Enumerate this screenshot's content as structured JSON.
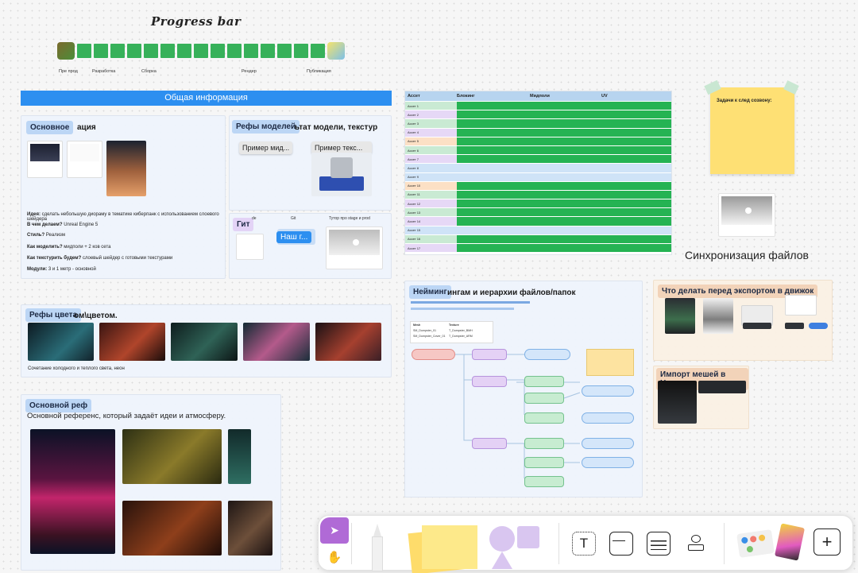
{
  "progress": {
    "title": "Progress bar",
    "done_fraction": 1.0,
    "stages": [
      "Пре прод",
      "Разработка",
      "Сборка",
      "Рендер",
      "Публикация"
    ]
  },
  "general": {
    "banner": "Общая информация"
  },
  "basic": {
    "tag": "Основное",
    "heading_rest": "ация",
    "idea_label": "Идея:",
    "idea_text": "сделать небольшую диораму в тематике киберпанк с использованием слоевого шейдера",
    "engine_label": "В чем делаем?",
    "engine_text": "Unreal Engine 5",
    "style_label": "Стиль?",
    "style_text": "Реализм",
    "model_label": "Как моделить?",
    "model_text": "мидполи + 2 ков сета",
    "texture_label": "Как текстурить будем?",
    "texture_text": "слоевый шейдер с готовыми текстурами",
    "modules_label": "Модули:",
    "modules_text": "3 и 1 метр - основной"
  },
  "model_refs": {
    "tag": "Рефы моделей",
    "heading_rest": "ьтат модели, текстур",
    "example1": "Пример мид...",
    "example2": "Пример текс..."
  },
  "git": {
    "tag": "Гит",
    "col1": "de",
    "col2": "Git",
    "col3": "Тутор про stage и prod",
    "button": "Наш г..."
  },
  "color_refs": {
    "tag": "Рефы цвета",
    "heading_rest": "ом\\цветом.",
    "caption": "Сочетание холодного и теплого света, неон"
  },
  "main_ref": {
    "tag": "Основной реф",
    "subtitle": "Основной референс, который задаёт идеи и атмосферу."
  },
  "sheet": {
    "headers": [
      "Ассет",
      "Блокинг",
      "Мидполи",
      "UV"
    ],
    "rows": [
      {
        "name": "Ассет 1",
        "type": "g"
      },
      {
        "name": "Ассет 2",
        "type": "g"
      },
      {
        "name": "Ассет 3",
        "type": "g"
      },
      {
        "name": "Ассет 4",
        "type": "g"
      },
      {
        "name": "Ассет 5",
        "type": "g"
      },
      {
        "name": "Ассет 6",
        "type": "g"
      },
      {
        "name": "Ассет 7",
        "type": "g"
      },
      {
        "name": "Ассет 8",
        "type": "b"
      },
      {
        "name": "Ассет 9",
        "type": "b"
      },
      {
        "name": "Ассет 10",
        "type": "g"
      },
      {
        "name": "Ассет 11",
        "type": "g"
      },
      {
        "name": "Ассет 12",
        "type": "g"
      },
      {
        "name": "Ассет 13",
        "type": "g"
      },
      {
        "name": "Ассет 14",
        "type": "g"
      },
      {
        "name": "Ассет 15",
        "type": "b"
      },
      {
        "name": "Ассет 16",
        "type": "g"
      },
      {
        "name": "Ассет 17",
        "type": "g"
      }
    ]
  },
  "sticky": {
    "title": "Задачи к след созвону:"
  },
  "sync": {
    "title": "Синхронизация файлов"
  },
  "naming": {
    "tag": "Нейминг",
    "heading_rest": "ингам и иерархии файлов/папок",
    "mesh_label": "Mesh",
    "texture_label": "Texture",
    "mesh1": "SM_Dumpster_01",
    "mesh2": "SM_Dumpster_Cover_01",
    "tex1": "T_Dumpster_BMH",
    "tex2": "T_Dumpster_ARM"
  },
  "export": {
    "tag": "Что делать перед экспортом в движок"
  },
  "import": {
    "tag": "Импорт мешей в Unr..."
  },
  "toolbar": {
    "select_icon": "cursor-icon",
    "hand_icon": "hand-icon",
    "text_tool": "T",
    "plus": "+"
  },
  "colors": {
    "accent_blue": "#2d8ff0",
    "progress_green": "#37b15a",
    "sheet_green": "#25b353",
    "sticky_yellow": "#fee074",
    "tool_selected": "#b06ad6"
  }
}
